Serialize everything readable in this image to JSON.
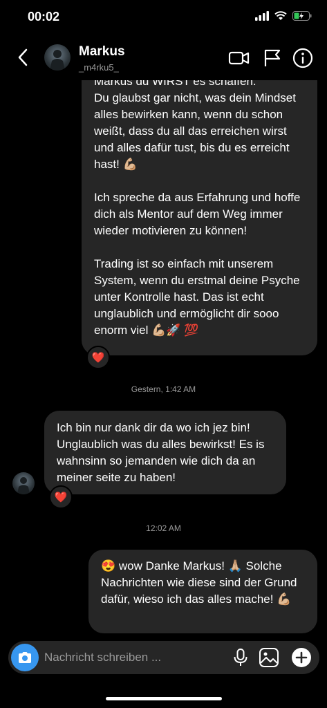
{
  "status": {
    "time": "00:02"
  },
  "header": {
    "name": "Markus",
    "handle": "_m4rku5_"
  },
  "messages": {
    "first": {
      "cut_line": "Markus du WIRST es schaffen.",
      "p1": "Du glaubst gar nicht, was dein Mindset alles bewirken kann, wenn du schon weißt, dass du all das erreichen wirst und alles dafür tust, bis du es erreicht hast! 💪🏼",
      "p2": "Ich spreche da aus Erfahrung und hoffe dich als Mentor auf dem Weg immer wieder motivieren zu können!",
      "p3": "Trading ist so einfach mit unserem System, wenn du erstmal deine Psyche unter Kontrolle hast. Das ist echt unglaublich und ermöglicht dir sooo enorm viel 💪🏼🚀 💯",
      "reaction": "❤️"
    },
    "stamp1": "Gestern, 1:42 AM",
    "second": {
      "text": "Ich bin nur dank dir da wo ich jez bin! Unglaublich was du alles bewirkst! Es is wahnsinn so jemanden wie dich da an meiner seite zu haben!",
      "reaction": "❤️"
    },
    "stamp2": "12:02 AM",
    "third": {
      "text": "😍 wow Danke Markus! 🙏🏼 Solche Nachrichten wie diese sind der Grund dafür, wieso ich das alles mache! 💪🏼"
    }
  },
  "composer": {
    "placeholder": "Nachricht schreiben ..."
  }
}
